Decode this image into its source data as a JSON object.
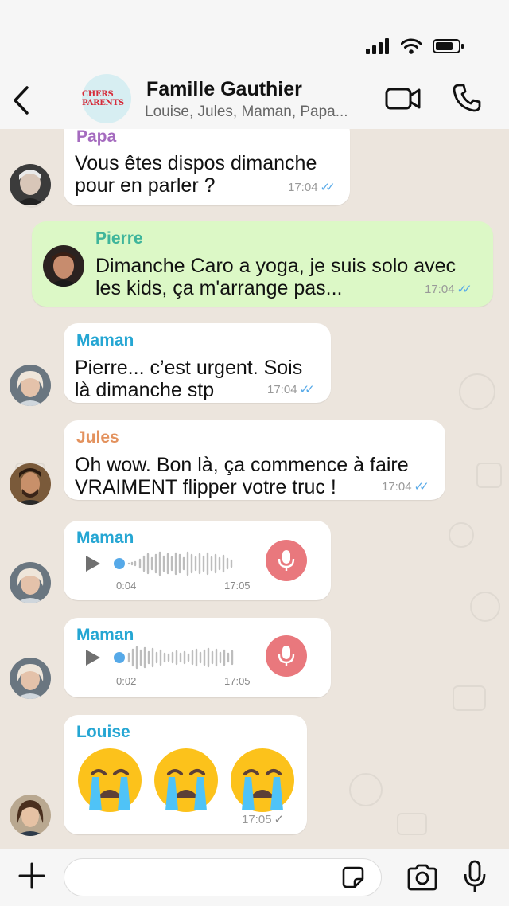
{
  "header": {
    "group_avatar_text": "CHERS PARENTS",
    "title": "Famille Gauthier",
    "subtitle": "Louise, Jules, Maman, Papa..."
  },
  "colors": {
    "papa": "#a56bbf",
    "pierre": "#3fb59b",
    "maman": "#25a6d3",
    "jules": "#e3925e",
    "louise": "#25a6d3",
    "own_bubble": "#dcf8c6",
    "read_ticks": "#56a9e8",
    "mic_red": "#e9787d"
  },
  "messages": [
    {
      "sender": "Papa",
      "text": "Vous êtes dispos dimanche\npour en parler ?",
      "time": "17:04",
      "status": "read"
    },
    {
      "sender": "Pierre",
      "text": "Dimanche Caro a yoga, je suis solo avec\nles kids, ça m'arrange pas...",
      "time": "17:04",
      "status": "read"
    },
    {
      "sender": "Maman",
      "text": "Pierre... c’est urgent. Sois\nlà dimanche stp",
      "time": "17:04",
      "status": "read"
    },
    {
      "sender": "Jules",
      "text": "Oh wow. Bon là, ça commence à faire\nVRAIMENT flipper votre truc !",
      "time": "17:04",
      "status": "read"
    },
    {
      "sender": "Maman",
      "type": "voice",
      "duration": "0:04",
      "time": "17:05",
      "progress": 0.0
    },
    {
      "sender": "Maman",
      "type": "voice",
      "duration": "0:02",
      "time": "17:05",
      "progress": 0.0
    },
    {
      "sender": "Louise",
      "type": "emoji",
      "emoji": "😭😭😭",
      "time": "17:05",
      "status": "sent"
    }
  ],
  "input": {
    "placeholder": ""
  },
  "icons": [
    "back-icon",
    "video-icon",
    "phone-icon",
    "plus-icon",
    "sticker-icon",
    "camera-icon",
    "mic-icon",
    "play-icon",
    "signal-icon",
    "wifi-icon",
    "battery-icon"
  ]
}
